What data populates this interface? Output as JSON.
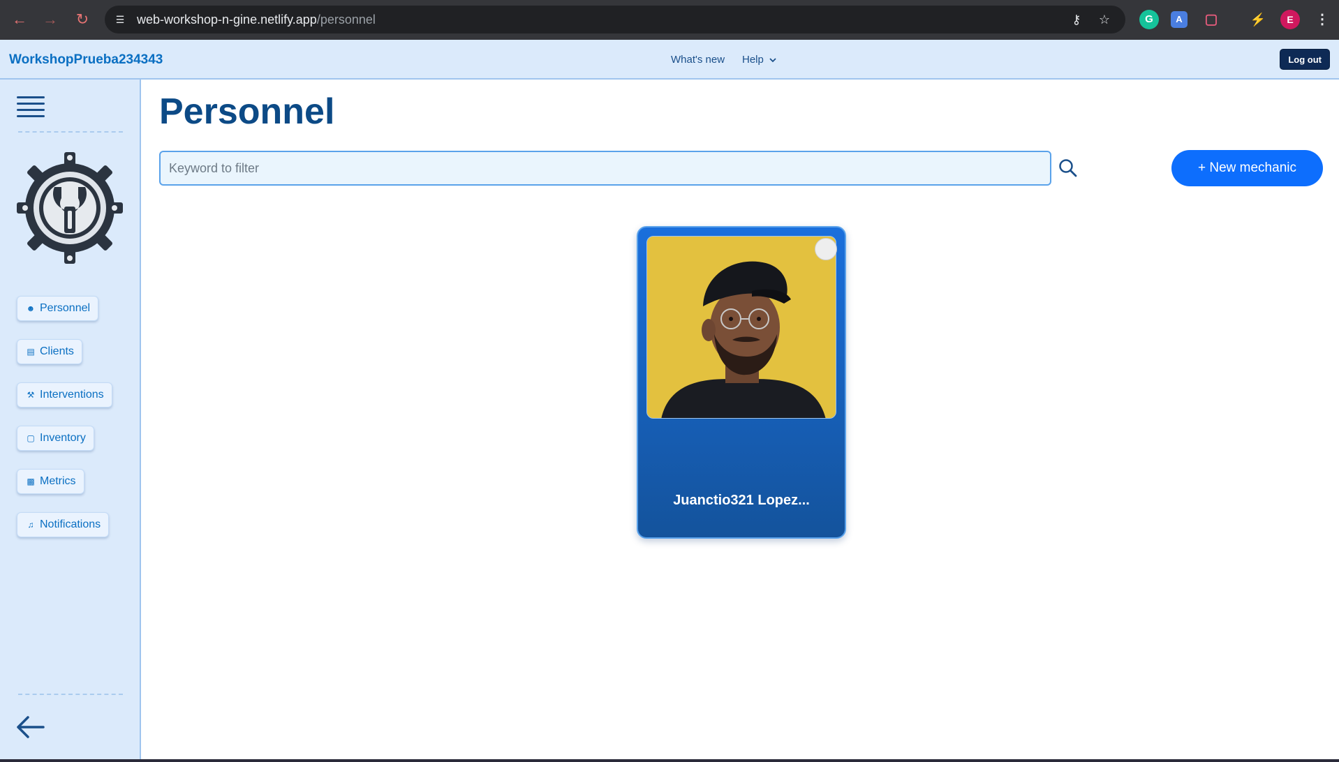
{
  "browser": {
    "url_host": "web-workshop-n-gine.netlify.app",
    "url_path": "/personnel",
    "profile_initial": "E",
    "icons": [
      "back-icon",
      "forward-icon",
      "reload-icon",
      "site-info-icon",
      "password-key-icon",
      "bookmark-star-icon",
      "grammarly-icon",
      "translate-icon",
      "extensions-icon",
      "performance-icon",
      "profile-avatar",
      "menu-icon"
    ]
  },
  "header": {
    "brand": "WorkshopPrueba234343",
    "whats_new": "What's new",
    "help": "Help",
    "logout": "Log out"
  },
  "sidebar": {
    "items": [
      {
        "label": "Personnel",
        "icon": "users-icon"
      },
      {
        "label": "Clients",
        "icon": "id-card-icon"
      },
      {
        "label": "Interventions",
        "icon": "hammer-icon"
      },
      {
        "label": "Inventory",
        "icon": "box-icon"
      },
      {
        "label": "Metrics",
        "icon": "bar-chart-icon"
      },
      {
        "label": "Notifications",
        "icon": "bell-icon"
      }
    ]
  },
  "main": {
    "title": "Personnel",
    "filter_placeholder": "Keyword to filter",
    "filter_value": "",
    "new_button": "+ New mechanic",
    "cards": [
      {
        "name": "Juanctio321 Lopez..."
      }
    ]
  },
  "colors": {
    "accent": "#0d6efd",
    "brand": "#0a6fc2",
    "title": "#0c4a86",
    "sidebar_bg": "#dbeafb",
    "card_top": "#1a6fdc",
    "card_bottom": "#14539c"
  }
}
